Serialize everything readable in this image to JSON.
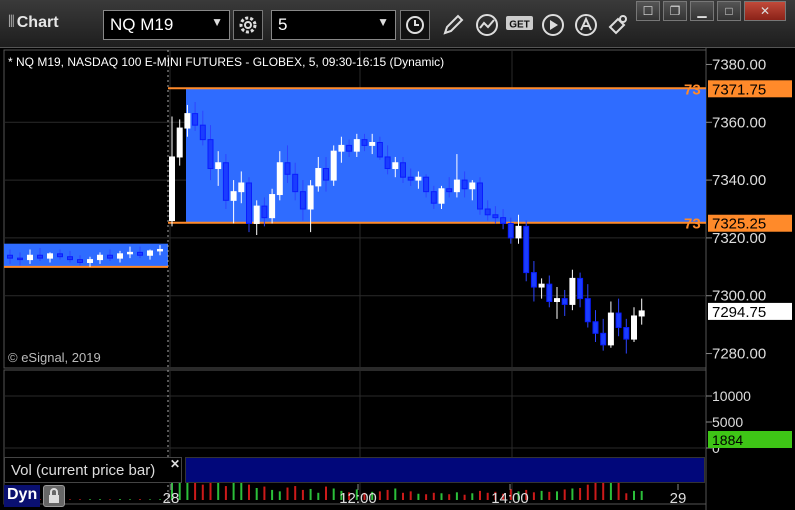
{
  "toolbar": {
    "title": "Chart",
    "symbol": "NQ M19",
    "interval": "5",
    "vendor_label": "GET"
  },
  "chart": {
    "header": "* NQ M19, NASDAQ 100 E-MINI FUTURES - GLOBEX, 5, 09:30-16:15 (Dynamic)",
    "watermark": "© eSignal, 2019",
    "price_ticks": [
      "7380.00",
      "7360.00",
      "7340.00",
      "7320.00",
      "7300.00",
      "7280.00"
    ],
    "volume_ticks": [
      "10000",
      "5000",
      "0"
    ],
    "time_ticks": [
      "28",
      "12:00",
      "14:00",
      "29"
    ],
    "last_price": "7294.75",
    "upper_line_price": "7371.75",
    "lower_line_price": "7325.25",
    "upper_line_prefix": "73",
    "lower_line_prefix": "73",
    "last_volume": "1884"
  },
  "colors": {
    "range_fill": "#2f6cff",
    "hline": "#ff8a2a",
    "up_candle": "#ffffff",
    "down_candle": "#1a3dff",
    "vol_up": "#2bbf3a",
    "vol_down": "#cc1a1a",
    "last_volume_bg": "#3ec516"
  },
  "study": {
    "label": "Vol (current price bar)"
  },
  "footer": {
    "mode": "Dyn"
  },
  "chart_data": {
    "type": "candlestick",
    "y_range": [
      7275,
      7385
    ],
    "ohlc": [
      {
        "o": 7314.0,
        "h": 7316.0,
        "l": 7311.0,
        "c": 7313.0
      },
      {
        "o": 7313.0,
        "h": 7315.0,
        "l": 7310.5,
        "c": 7312.5
      },
      {
        "o": 7312.5,
        "h": 7316.0,
        "l": 7311.0,
        "c": 7314.0
      },
      {
        "o": 7314.0,
        "h": 7316.5,
        "l": 7312.0,
        "c": 7313.0
      },
      {
        "o": 7313.0,
        "h": 7315.0,
        "l": 7311.5,
        "c": 7314.5
      },
      {
        "o": 7314.5,
        "h": 7316.0,
        "l": 7312.5,
        "c": 7313.5
      },
      {
        "o": 7313.5,
        "h": 7315.5,
        "l": 7311.5,
        "c": 7312.5
      },
      {
        "o": 7312.5,
        "h": 7314.0,
        "l": 7310.5,
        "c": 7311.5
      },
      {
        "o": 7311.5,
        "h": 7313.5,
        "l": 7310.0,
        "c": 7312.5
      },
      {
        "o": 7312.5,
        "h": 7315.0,
        "l": 7311.0,
        "c": 7314.0
      },
      {
        "o": 7314.0,
        "h": 7316.0,
        "l": 7312.0,
        "c": 7313.0
      },
      {
        "o": 7313.0,
        "h": 7315.5,
        "l": 7311.5,
        "c": 7314.5
      },
      {
        "o": 7314.5,
        "h": 7317.0,
        "l": 7313.0,
        "c": 7315.0
      },
      {
        "o": 7315.0,
        "h": 7317.0,
        "l": 7313.0,
        "c": 7314.0
      },
      {
        "o": 7314.0,
        "h": 7316.0,
        "l": 7312.5,
        "c": 7315.5
      },
      {
        "o": 7315.5,
        "h": 7317.5,
        "l": 7314.0,
        "c": 7316.0
      },
      {
        "o": 7326.0,
        "h": 7362.0,
        "l": 7324.0,
        "c": 7348.0
      },
      {
        "o": 7348.0,
        "h": 7361.0,
        "l": 7345.0,
        "c": 7358.0
      },
      {
        "o": 7358.0,
        "h": 7366.0,
        "l": 7355.0,
        "c": 7363.0
      },
      {
        "o": 7363.0,
        "h": 7367.0,
        "l": 7357.0,
        "c": 7359.0
      },
      {
        "o": 7359.0,
        "h": 7364.0,
        "l": 7352.0,
        "c": 7354.0
      },
      {
        "o": 7354.0,
        "h": 7359.0,
        "l": 7340.0,
        "c": 7344.0
      },
      {
        "o": 7344.0,
        "h": 7350.0,
        "l": 7338.0,
        "c": 7346.0
      },
      {
        "o": 7346.0,
        "h": 7349.0,
        "l": 7330.0,
        "c": 7333.0
      },
      {
        "o": 7333.0,
        "h": 7340.0,
        "l": 7325.0,
        "c": 7336.0
      },
      {
        "o": 7336.0,
        "h": 7343.0,
        "l": 7332.0,
        "c": 7339.0
      },
      {
        "o": 7339.0,
        "h": 7341.0,
        "l": 7322.0,
        "c": 7325.0
      },
      {
        "o": 7325.0,
        "h": 7333.0,
        "l": 7321.0,
        "c": 7331.0
      },
      {
        "o": 7331.0,
        "h": 7334.0,
        "l": 7324.0,
        "c": 7327.0
      },
      {
        "o": 7327.0,
        "h": 7337.0,
        "l": 7325.0,
        "c": 7335.0
      },
      {
        "o": 7335.0,
        "h": 7350.0,
        "l": 7333.0,
        "c": 7346.0
      },
      {
        "o": 7346.0,
        "h": 7352.0,
        "l": 7339.0,
        "c": 7342.0
      },
      {
        "o": 7342.0,
        "h": 7346.0,
        "l": 7333.0,
        "c": 7336.0
      },
      {
        "o": 7336.0,
        "h": 7340.0,
        "l": 7326.0,
        "c": 7330.0
      },
      {
        "o": 7330.0,
        "h": 7340.0,
        "l": 7322.0,
        "c": 7338.0
      },
      {
        "o": 7338.0,
        "h": 7348.0,
        "l": 7336.0,
        "c": 7344.0
      },
      {
        "o": 7344.0,
        "h": 7348.0,
        "l": 7336.0,
        "c": 7340.0
      },
      {
        "o": 7340.0,
        "h": 7352.0,
        "l": 7338.0,
        "c": 7350.0
      },
      {
        "o": 7350.0,
        "h": 7355.0,
        "l": 7346.0,
        "c": 7352.0
      },
      {
        "o": 7352.0,
        "h": 7354.0,
        "l": 7348.0,
        "c": 7350.0
      },
      {
        "o": 7350.0,
        "h": 7356.0,
        "l": 7348.0,
        "c": 7354.0
      },
      {
        "o": 7354.0,
        "h": 7356.0,
        "l": 7350.0,
        "c": 7352.0
      },
      {
        "o": 7352.0,
        "h": 7356.0,
        "l": 7349.0,
        "c": 7353.0
      },
      {
        "o": 7353.0,
        "h": 7355.0,
        "l": 7347.0,
        "c": 7348.0
      },
      {
        "o": 7348.0,
        "h": 7352.0,
        "l": 7342.0,
        "c": 7344.0
      },
      {
        "o": 7344.0,
        "h": 7348.0,
        "l": 7341.0,
        "c": 7346.0
      },
      {
        "o": 7346.0,
        "h": 7348.0,
        "l": 7339.0,
        "c": 7341.0
      },
      {
        "o": 7341.0,
        "h": 7344.0,
        "l": 7338.0,
        "c": 7340.0
      },
      {
        "o": 7340.0,
        "h": 7343.0,
        "l": 7337.0,
        "c": 7341.0
      },
      {
        "o": 7341.0,
        "h": 7342.0,
        "l": 7334.0,
        "c": 7336.0
      },
      {
        "o": 7336.0,
        "h": 7338.0,
        "l": 7330.0,
        "c": 7332.0
      },
      {
        "o": 7332.0,
        "h": 7338.0,
        "l": 7330.0,
        "c": 7337.0
      },
      {
        "o": 7337.0,
        "h": 7341.0,
        "l": 7334.0,
        "c": 7336.0
      },
      {
        "o": 7336.0,
        "h": 7349.0,
        "l": 7334.0,
        "c": 7340.0
      },
      {
        "o": 7340.0,
        "h": 7343.0,
        "l": 7334.0,
        "c": 7337.0
      },
      {
        "o": 7337.0,
        "h": 7340.0,
        "l": 7333.0,
        "c": 7339.0
      },
      {
        "o": 7339.0,
        "h": 7341.0,
        "l": 7328.0,
        "c": 7330.0
      },
      {
        "o": 7330.0,
        "h": 7333.0,
        "l": 7326.0,
        "c": 7328.0
      },
      {
        "o": 7328.0,
        "h": 7331.0,
        "l": 7325.0,
        "c": 7327.0
      },
      {
        "o": 7327.0,
        "h": 7330.0,
        "l": 7323.0,
        "c": 7325.0
      },
      {
        "o": 7325.0,
        "h": 7327.0,
        "l": 7318.0,
        "c": 7320.0
      },
      {
        "o": 7320.0,
        "h": 7328.0,
        "l": 7318.0,
        "c": 7324.0
      },
      {
        "o": 7324.0,
        "h": 7326.0,
        "l": 7305.0,
        "c": 7308.0
      },
      {
        "o": 7308.0,
        "h": 7312.0,
        "l": 7298.0,
        "c": 7303.0
      },
      {
        "o": 7303.0,
        "h": 7306.0,
        "l": 7299.0,
        "c": 7304.0
      },
      {
        "o": 7304.0,
        "h": 7307.0,
        "l": 7296.0,
        "c": 7298.0
      },
      {
        "o": 7298.0,
        "h": 7303.0,
        "l": 7292.0,
        "c": 7299.0
      },
      {
        "o": 7299.0,
        "h": 7302.0,
        "l": 7293.0,
        "c": 7297.0
      },
      {
        "o": 7297.0,
        "h": 7309.0,
        "l": 7295.0,
        "c": 7306.0
      },
      {
        "o": 7306.0,
        "h": 7308.0,
        "l": 7296.0,
        "c": 7299.0
      },
      {
        "o": 7299.0,
        "h": 7304.0,
        "l": 7289.0,
        "c": 7291.0
      },
      {
        "o": 7291.0,
        "h": 7295.0,
        "l": 7284.0,
        "c": 7287.0
      },
      {
        "o": 7287.0,
        "h": 7292.0,
        "l": 7281.0,
        "c": 7283.0
      },
      {
        "o": 7283.0,
        "h": 7298.0,
        "l": 7282.0,
        "c": 7294.0
      },
      {
        "o": 7294.0,
        "h": 7299.0,
        "l": 7286.0,
        "c": 7289.0
      },
      {
        "o": 7289.0,
        "h": 7292.0,
        "l": 7280.0,
        "c": 7285.0
      },
      {
        "o": 7285.0,
        "h": 7296.0,
        "l": 7284.0,
        "c": 7293.0
      },
      {
        "o": 7293.0,
        "h": 7299.0,
        "l": 7290.0,
        "c": 7294.75
      }
    ],
    "volume": [
      150,
      120,
      140,
      130,
      110,
      160,
      120,
      130,
      140,
      150,
      110,
      170,
      130,
      160,
      120,
      140,
      8800,
      6200,
      5600,
      4300,
      3200,
      4100,
      3800,
      2900,
      4800,
      4500,
      3200,
      2500,
      2800,
      2100,
      1800,
      2600,
      2900,
      2100,
      2300,
      1500,
      2800,
      2400,
      1900,
      1600,
      2200,
      1500,
      1700,
      1800,
      2100,
      2400,
      1500,
      1800,
      1300,
      1200,
      1500,
      1400,
      1200,
      1600,
      1100,
      1400,
      1900,
      1500,
      1700,
      1300,
      2300,
      1800,
      2100,
      1600,
      1900,
      1700,
      1800,
      2200,
      2400,
      2500,
      3200,
      3600,
      4700,
      3800,
      4200,
      1400,
      1900,
      1884
    ]
  }
}
